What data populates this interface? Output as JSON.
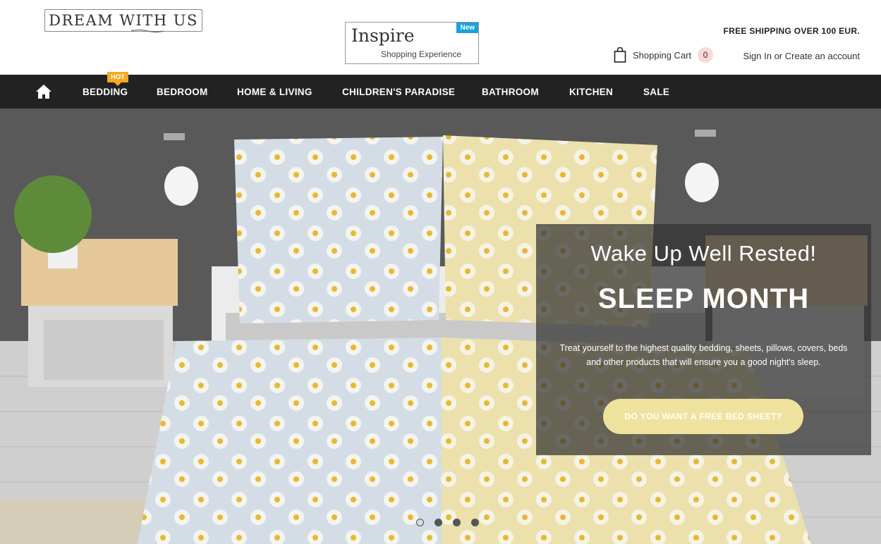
{
  "header": {
    "logo_text": "DREAM WITH US",
    "inspire": {
      "word": "Inspire",
      "subtitle": "Shopping Experience",
      "badge": "New"
    },
    "free_shipping": "FREE SHIPPING OVER 100 EUR.",
    "cart": {
      "label": "Shopping Cart",
      "count": "0"
    },
    "account": {
      "sign_in": "Sign In",
      "or": "or",
      "create": "Create an account"
    }
  },
  "nav": {
    "home_icon": "home-icon",
    "hot_badge": "HOT",
    "items": [
      {
        "label": "BEDDING"
      },
      {
        "label": "BEDROOM"
      },
      {
        "label": "HOME & LIVING"
      },
      {
        "label": "CHILDREN'S PARADISE"
      },
      {
        "label": "BATHROOM"
      },
      {
        "label": "KITCHEN"
      },
      {
        "label": "SALE"
      }
    ]
  },
  "hero": {
    "tagline": "Wake Up Well Rested!",
    "title": "SLEEP MONTH",
    "text": "Treat yourself to the highest quality bedding, sheets, pillows, covers, beds and other products that will ensure you a good night's sleep.",
    "button": "DO YOU WANT A FREE BED SHEET?",
    "slides": 4,
    "active_slide": 1
  },
  "colors": {
    "nav_bg": "#222222",
    "hot_badge": "#f6a821",
    "new_badge": "#1aa3d9",
    "cta_button": "#efe29e",
    "cart_count_bg": "#f9d9d4"
  }
}
